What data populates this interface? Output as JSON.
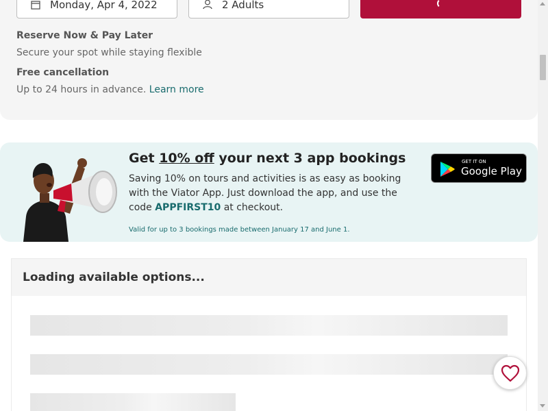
{
  "booking": {
    "date_value": "Monday, Apr 4, 2022",
    "travelers_value": "2 Adults",
    "button_color": "#b0103a",
    "icons": {
      "date": "calendar-icon",
      "travelers": "person-icon",
      "button": "loading-spinner-icon"
    }
  },
  "features": {
    "reserve_title": "Reserve Now & Pay Later",
    "reserve_desc": "Secure your spot while staying flexible",
    "cancel_title": "Free cancellation",
    "cancel_desc": "Up to 24 hours in advance.",
    "learn_more": "Learn more"
  },
  "promo": {
    "title_prefix": "Get ",
    "title_highlight": "10% off",
    "title_suffix": " your next 3 app bookings",
    "text": "Saving 10% on tours and activities is as easy as booking with the Viator App. Just download the app, and use the code ",
    "code": "APPFIRST10",
    "text_suffix": " at checkout.",
    "fine_print": "Valid for up to 3 bookings made between January 17 and June 1.",
    "store_badge_small": "GET IT ON",
    "store_badge_big": "Google Play",
    "accent_color": "#186b6d",
    "background_color": "#e8f4f4"
  },
  "options": {
    "heading": "Loading available options..."
  },
  "favorite": {
    "icon": "heart-icon",
    "color": "#b0103a"
  }
}
